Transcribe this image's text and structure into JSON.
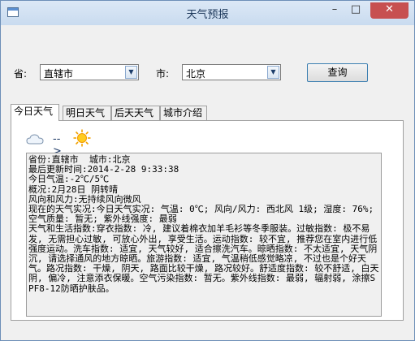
{
  "window": {
    "title": "天气预报",
    "minimize_glyph": "–",
    "maximize_glyph": "□",
    "close_glyph": "✕"
  },
  "form": {
    "province_label": "省:",
    "province_value": "直辖市",
    "city_label": "市:",
    "city_value": "北京",
    "query_button": "查询"
  },
  "tabs": [
    {
      "label": "今日天气",
      "active": true
    },
    {
      "label": "明日天气",
      "active": false
    },
    {
      "label": "后天天气",
      "active": false
    },
    {
      "label": "城市介绍",
      "active": false
    }
  ],
  "icons": {
    "from": "cloud-icon",
    "arrow": "-->",
    "to": "sun-icon"
  },
  "details": {
    "lines": [
      "省份:直辖市  城市:北京",
      "最后更新时间:2014-2-28 9:33:38",
      "今日气温:-2℃/5℃",
      "概况:2月28日 阴转晴",
      "风向和风力:无持续风向微风",
      "现在的天气实况:今日天气实况: 气温: 0℃; 风向/风力: 西北风 1级; 湿度: 76%; 空气质量: 暂无; 紫外线强度: 最弱",
      "天气和生活指数:穿衣指数: 冷, 建议着棉衣加羊毛衫等冬季服装。过敏指数: 极不易发, 无需担心过敏, 可放心外出, 享受生活。运动指数: 较不宜, 推荐您在室内进行低强度运动。洗车指数: 适宜, 天气较好, 适合擦洗汽车。晾晒指数: 不太适宜, 天气阴沉, 请选择通风的地方晾晒。旅游指数: 适宜, 气温稍低感觉略凉, 不过也是个好天气。路况指数: 干燥, 阴天, 路面比较干燥, 路况较好。舒适度指数: 较不舒适, 白天阴, 偏冷, 注意添衣保暖。空气污染指数: 暂无。紫外线指数: 最弱, 辐射弱, 涂擦SPF8-12防晒护肤品。"
    ]
  }
}
